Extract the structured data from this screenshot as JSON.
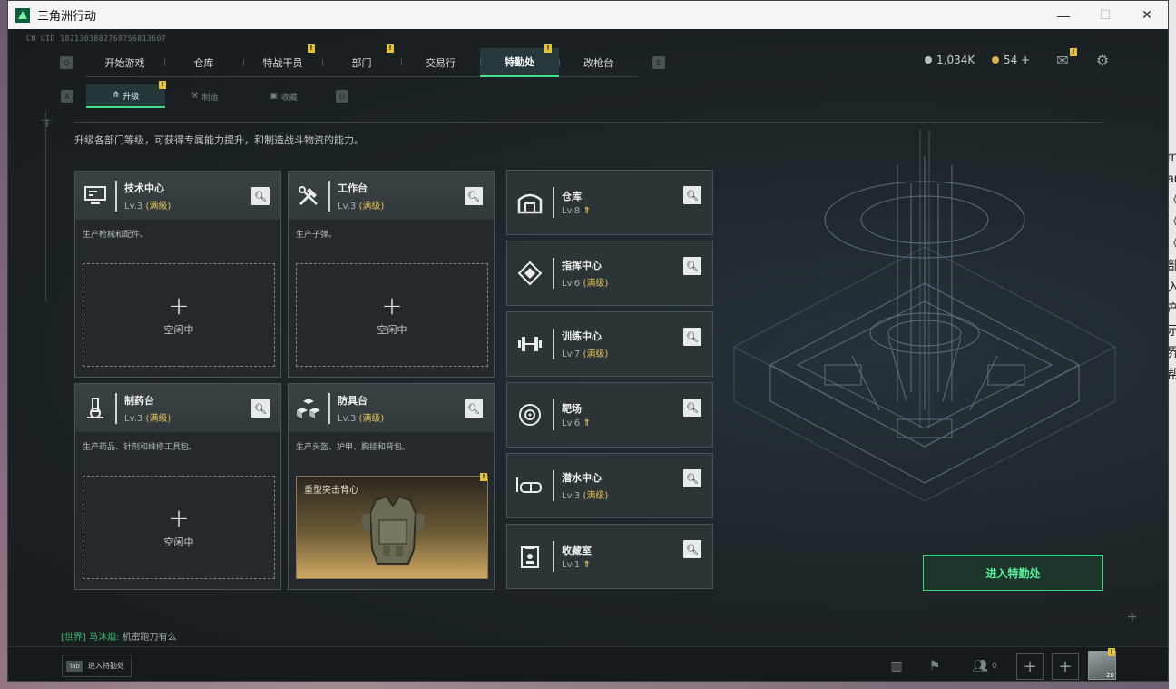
{
  "window": {
    "title": "三角洲行动"
  },
  "uid": "CN UID 1821303882768756813607",
  "nav": {
    "left_key": "Q",
    "right_key": "E",
    "tabs": [
      {
        "label": "开始游戏",
        "badge": ""
      },
      {
        "label": "仓库",
        "badge": ""
      },
      {
        "label": "特战干员",
        "badge": "!"
      },
      {
        "label": "部门",
        "badge": "!"
      },
      {
        "label": "交易行",
        "badge": ""
      },
      {
        "label": "特勤处",
        "badge": "!",
        "active": true
      },
      {
        "label": "改枪台",
        "badge": ""
      }
    ]
  },
  "currency": {
    "silver": "1,034K",
    "gold": "54 +",
    "silver_color": "#b9c0c2",
    "gold_color": "#d9b255"
  },
  "subnav": {
    "left_key": "A",
    "right_key": "D",
    "tabs": [
      {
        "label": "升级",
        "icon": "upgrade-icon",
        "active": true
      },
      {
        "label": "制造",
        "icon": "craft-icon"
      },
      {
        "label": "收藏",
        "icon": "collection-icon"
      }
    ]
  },
  "description": "升级各部门等级，可获得专属能力提升，和制造战斗物资的能力。",
  "lv_max_label": "(满级)",
  "idle_label": "空闲中",
  "workshops": [
    {
      "name": "技术中心",
      "level": "Lv.3",
      "desc": "生产枪械和配件。",
      "icon": "tech-center-icon"
    },
    {
      "name": "工作台",
      "level": "Lv.3",
      "desc": "生产子弹。",
      "icon": "workbench-icon"
    },
    {
      "name": "制药台",
      "level": "Lv.3",
      "desc": "生产药品、针剂和维修工具包。",
      "icon": "pharmacy-icon"
    },
    {
      "name": "防具台",
      "level": "Lv.3",
      "desc": "生产头盔、护甲、胸挂和背包。",
      "icon": "armor-bench-icon",
      "item": "重型突击背心"
    }
  ],
  "facilities": [
    {
      "name": "仓库",
      "level": "Lv.8",
      "status": "upgradable",
      "icon": "warehouse-icon"
    },
    {
      "name": "指挥中心",
      "level": "Lv.6",
      "status": "max",
      "icon": "command-center-icon"
    },
    {
      "name": "训练中心",
      "level": "Lv.7",
      "status": "max",
      "icon": "training-center-icon"
    },
    {
      "name": "靶场",
      "level": "Lv.6",
      "status": "upgradable",
      "icon": "shooting-range-icon"
    },
    {
      "name": "潜水中心",
      "level": "Lv.3",
      "status": "max",
      "icon": "diving-center-icon"
    },
    {
      "name": "收藏室",
      "level": "Lv.1",
      "status": "upgradable",
      "icon": "collection-room-icon"
    }
  ],
  "enter_button": "进入特勤处",
  "chat": {
    "channel": "[世界]",
    "user": "马沐烟:",
    "message": "机密跑刀有么"
  },
  "bottom": {
    "tab_key": "Tab",
    "tab_label": "进入特勤处",
    "friends_count": "0",
    "level": "20"
  },
  "accent_color": "#43e08a"
}
